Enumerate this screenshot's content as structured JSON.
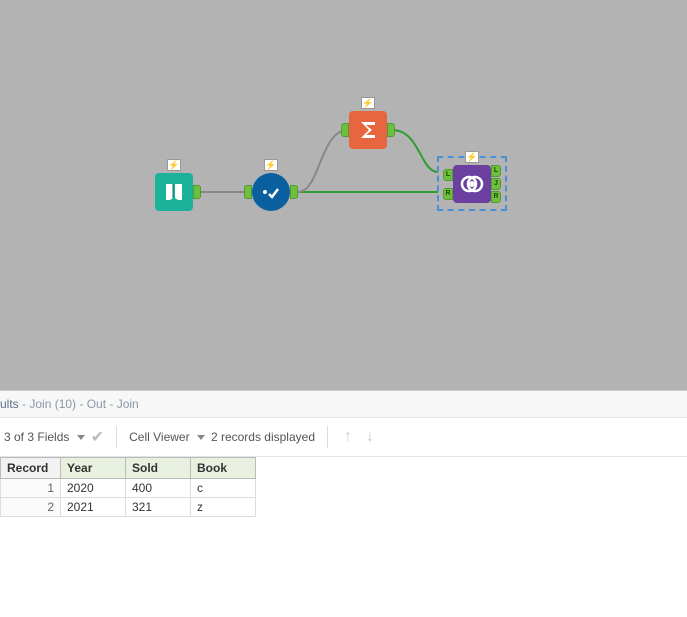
{
  "canvas": {
    "nodes": {
      "input": {
        "name": "Input Data",
        "lightning": true
      },
      "select": {
        "name": "Select",
        "lightning": true
      },
      "summarize": {
        "name": "Summarize",
        "lightning": true
      },
      "join": {
        "name": "Join",
        "lightning": true,
        "selected": true,
        "left_anchors": [
          "L",
          "R"
        ],
        "right_anchors": [
          "L",
          "J",
          "R"
        ]
      }
    }
  },
  "results": {
    "header_prefix": "ults",
    "header_rest": " - Join (10) - Out - Join",
    "toolbar": {
      "fields": "3 of 3 Fields",
      "cell_viewer_label": "Cell Viewer",
      "records_text": "2 records displayed"
    },
    "columns": [
      "Record",
      "Year",
      "Sold",
      "Book"
    ],
    "rows": [
      {
        "record": "1",
        "year": "2020",
        "sold": "400",
        "book": "c"
      },
      {
        "record": "2",
        "year": "2021",
        "sold": "321",
        "book": "z"
      }
    ]
  },
  "icons": {
    "bolt": "⚡",
    "check": "✔",
    "up": "↑",
    "down": "↓"
  }
}
